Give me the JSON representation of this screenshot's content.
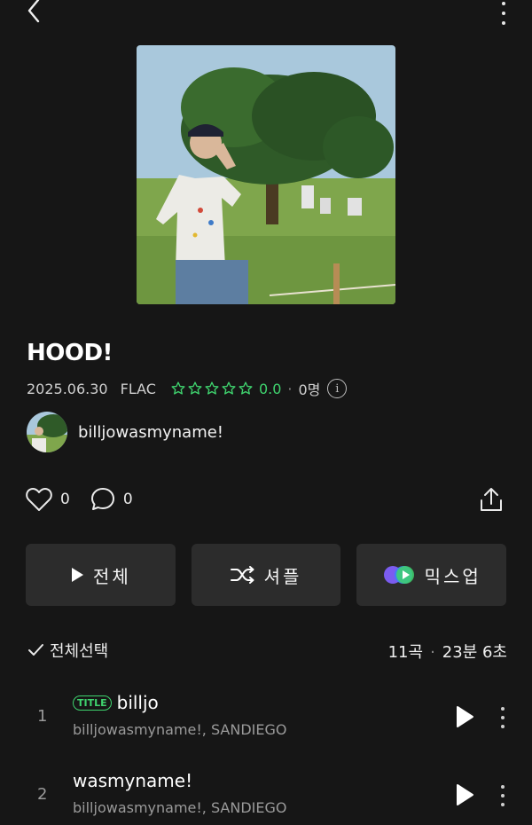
{
  "header": {
    "back_icon": "chevron-left-icon",
    "more_icon": "more-vertical-icon"
  },
  "album": {
    "title": "HOOD!",
    "date": "2025.06.30",
    "format": "FLAC",
    "rating": "0.0",
    "rating_stars": 5,
    "rating_color": "#3fd36e",
    "raters": "0명",
    "artist": "billjowasmyname!"
  },
  "social": {
    "likes": "0",
    "comments": "0"
  },
  "buttons": {
    "play_all": "전체",
    "shuffle": "셔플",
    "mixup": "믹스업"
  },
  "list": {
    "select_all": "전체선택",
    "track_count": "11곡",
    "duration": "23분 6초"
  },
  "tracks": [
    {
      "number": "1",
      "badge": "TITLE",
      "title": "billjo",
      "artist": "billjowasmyname!, SANDIEGO"
    },
    {
      "number": "2",
      "title": "wasmyname!",
      "artist": "billjowasmyname!, SANDIEGO"
    }
  ]
}
